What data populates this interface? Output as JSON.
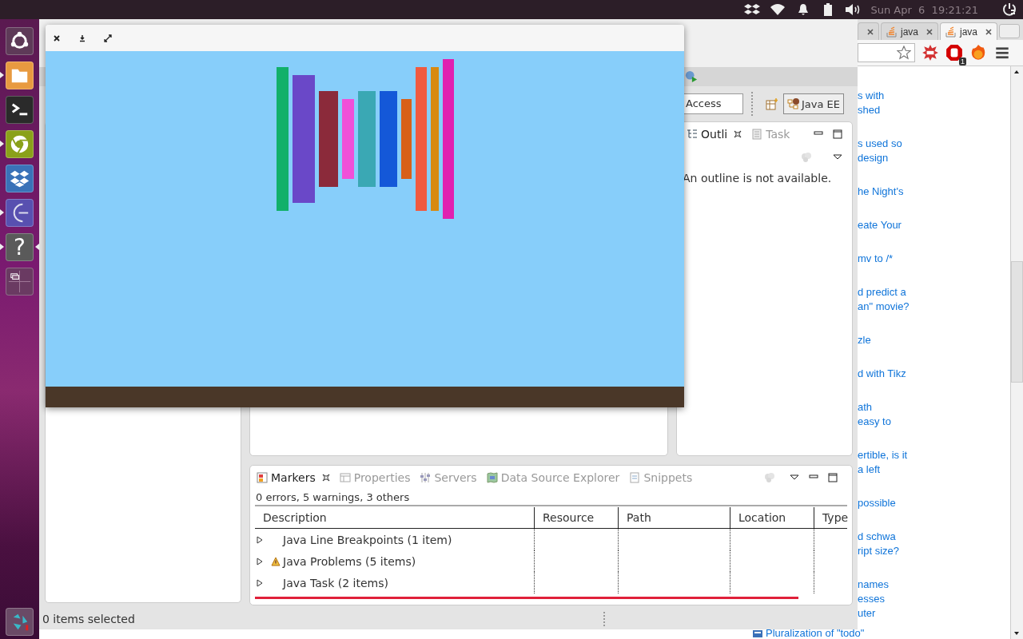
{
  "top_panel": {
    "clock": "Sun Apr  6  19:21:21"
  },
  "launcher": {
    "items": [
      {
        "kind": "ubuntu",
        "running": false,
        "focused": false
      },
      {
        "kind": "files",
        "running": true,
        "focused": false
      },
      {
        "kind": "terminal",
        "running": false,
        "focused": false
      },
      {
        "kind": "chrome",
        "running": true,
        "focused": false
      },
      {
        "kind": "dropbox",
        "running": false,
        "focused": false
      },
      {
        "kind": "arc",
        "running": true,
        "focused": false
      },
      {
        "kind": "help",
        "label": "?",
        "running": true,
        "focused": true
      },
      {
        "kind": "workspaces",
        "running": false,
        "focused": false
      }
    ]
  },
  "browser": {
    "tabs": [
      {
        "label": "java",
        "selected": false
      },
      {
        "label": "java",
        "selected": true
      }
    ],
    "extension_badge": "1",
    "links": [
      "s with\nshed",
      "s used so\ndesign",
      "he Night's",
      "eate Your",
      "mv to /*",
      "d predict a\nan\" movie?",
      "zle",
      "d with Tikz",
      "ath\neasy to",
      "ertible, is it\na left",
      "possible",
      "d schwa\nript size?",
      "names\nesses\nuter"
    ],
    "bottom_link": "Pluralization of \"todo\""
  },
  "eclipse": {
    "quick_access": {
      "value": "Access"
    },
    "perspective": {
      "label": "Java EE",
      "selected": true
    },
    "outline": {
      "tabs": [
        {
          "label": "Outli",
          "selected": true,
          "kind": "outline"
        },
        {
          "label": "Task",
          "selected": false,
          "kind": "task"
        }
      ],
      "message": "An outline is not available."
    },
    "markers": {
      "tabs": [
        {
          "label": "Markers",
          "selected": true,
          "kind": "markers"
        },
        {
          "label": "Properties",
          "selected": false,
          "kind": "properties"
        },
        {
          "label": "Servers",
          "selected": false,
          "kind": "servers"
        },
        {
          "label": "Data Source Explorer",
          "selected": false,
          "kind": "datasource"
        },
        {
          "label": "Snippets",
          "selected": false,
          "kind": "snippets"
        }
      ],
      "summary": "0 errors, 5 warnings, 3 others",
      "columns": [
        "Description",
        "Resource",
        "Path",
        "Location",
        "Type"
      ],
      "rows": [
        {
          "label": "Java Line Breakpoints (1 item)",
          "kind": "plain",
          "expanded": false
        },
        {
          "label": "Java Problems (5 items)",
          "kind": "warning",
          "expanded": false
        },
        {
          "label": "Java Task (2 items)",
          "kind": "plain",
          "expanded": false
        }
      ]
    },
    "status_bar": {
      "text": "0 items selected"
    }
  }
}
